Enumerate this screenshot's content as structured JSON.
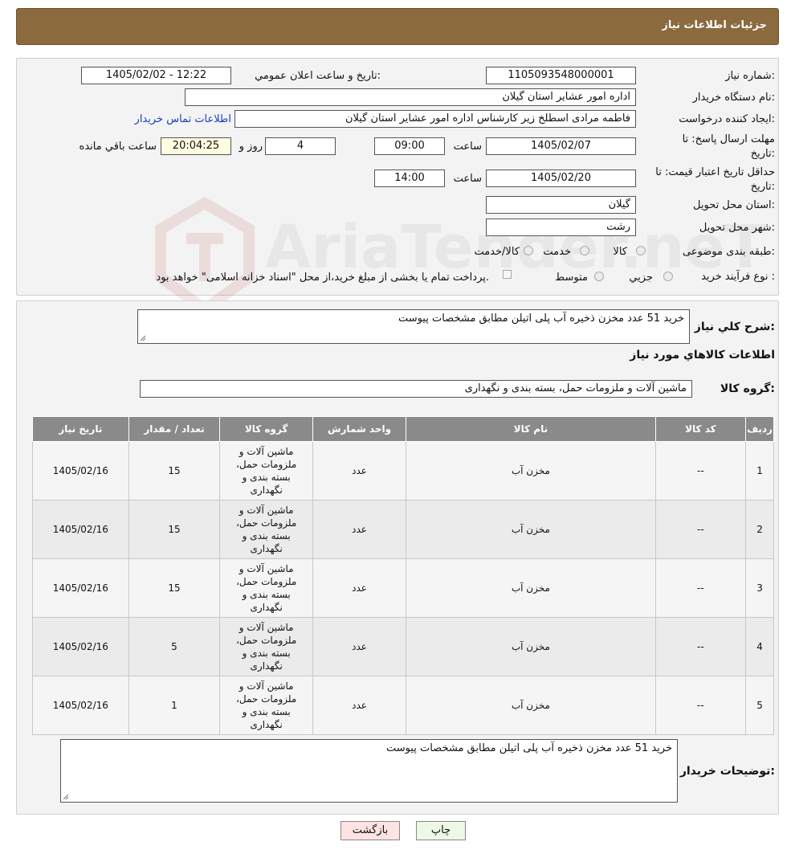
{
  "header": {
    "title": "جزئیات اطلاعات نیاز"
  },
  "form": {
    "need_number_label": "شماره نیاز:",
    "need_number": "1105093548000001",
    "announce_label": "تاریخ و ساعت اعلان عمومي:",
    "announce_value": "1405/02/02 - 12:22",
    "buyer_org_label": "نام دستگاه خريدار:",
    "buyer_org": "اداره امور عشاير استان گيلان",
    "requester_label": "ايجاد كننده درخواست:",
    "requester": "فاطمه مرادی اسطلخ زیر کارشناس اداره امور عشاير استان گيلان",
    "contact_link": "اطلاعات تماس خريدار",
    "deadline_label_1": "مهلت ارسال پاسخ: تا",
    "deadline_label_2": "تاريخ:",
    "deadline_date": "1405/02/07",
    "time_label": "ساعت",
    "deadline_time": "09:00",
    "days_value": "4",
    "days_label": "روز و",
    "remaining_time": "20:04:25",
    "remaining_label": "ساعت باقي مانده",
    "validity_label_1": "حداقل تاريخ اعتبار قيمت: تا",
    "validity_label_2": "تاريخ:",
    "validity_date": "1405/02/20",
    "validity_time": "14:00",
    "province_label": "استان محل تحويل:",
    "province": "گيلان",
    "city_label": "شهر محل تحويل:",
    "city": "رشت",
    "category_label": "طبقه بندی موضوعی:",
    "category_options": [
      "كالا",
      "خدمت",
      "كالا/خدمت"
    ],
    "process_label": "نوع فرآيند خريد :",
    "process_options": [
      "جزيي",
      "متوسط"
    ],
    "process_note": "پرداخت تمام يا بخشی از مبلغ خريد،از محل \"اسناد خزانه اسلامی\" خواهد بود."
  },
  "details": {
    "desc_label": "شرح كلي نياز:",
    "desc": "خريد 51 عدد مخزن ذخيره آب پلی اتيلن مطابق مشخصات پيوست",
    "goods_info_title": "اطلاعات كالاهاي مورد نياز",
    "goods_group_label": "گروه كالا:",
    "goods_group": "ماشين آلات و ملزومات حمل، بسته بندی و نگهداری",
    "table_headers": [
      "رديف",
      "كد كالا",
      "نام كالا",
      "واحد شمارش",
      "گروه كالا",
      "تعداد / مقدار",
      "تاريخ نياز"
    ],
    "rows": [
      {
        "n": "1",
        "code": "--",
        "name": "مخزن آب",
        "unit": "عدد",
        "group": "ماشين آلات و ملزومات حمل، بسته بندی و نگهداری",
        "qty": "15",
        "date": "1405/02/16"
      },
      {
        "n": "2",
        "code": "--",
        "name": "مخزن آب",
        "unit": "عدد",
        "group": "ماشين آلات و ملزومات حمل، بسته بندی و نگهداری",
        "qty": "15",
        "date": "1405/02/16"
      },
      {
        "n": "3",
        "code": "--",
        "name": "مخزن آب",
        "unit": "عدد",
        "group": "ماشين آلات و ملزومات حمل، بسته بندی و نگهداری",
        "qty": "15",
        "date": "1405/02/16"
      },
      {
        "n": "4",
        "code": "--",
        "name": "مخزن آب",
        "unit": "عدد",
        "group": "ماشين آلات و ملزومات حمل، بسته بندی و نگهداری",
        "qty": "5",
        "date": "1405/02/16"
      },
      {
        "n": "5",
        "code": "--",
        "name": "مخزن آب",
        "unit": "عدد",
        "group": "ماشين آلات و ملزومات حمل، بسته بندی و نگهداری",
        "qty": "1",
        "date": "1405/02/16"
      }
    ],
    "buyer_notes_label": "توضيحات خريدار:",
    "buyer_notes": "خريد 51 عدد مخزن ذخيره آب پلی اتيلن مطابق مشخصات پيوست"
  },
  "buttons": {
    "print": "چاپ",
    "back": "بازگشت"
  },
  "watermark": {
    "text": "AriaTender.neT"
  },
  "colors": {
    "header_bg": "#8b6a3e",
    "table_header_bg": "#8a8a8a",
    "back_btn_bg": "#fde3e3",
    "print_btn_bg": "#eef8e6"
  }
}
